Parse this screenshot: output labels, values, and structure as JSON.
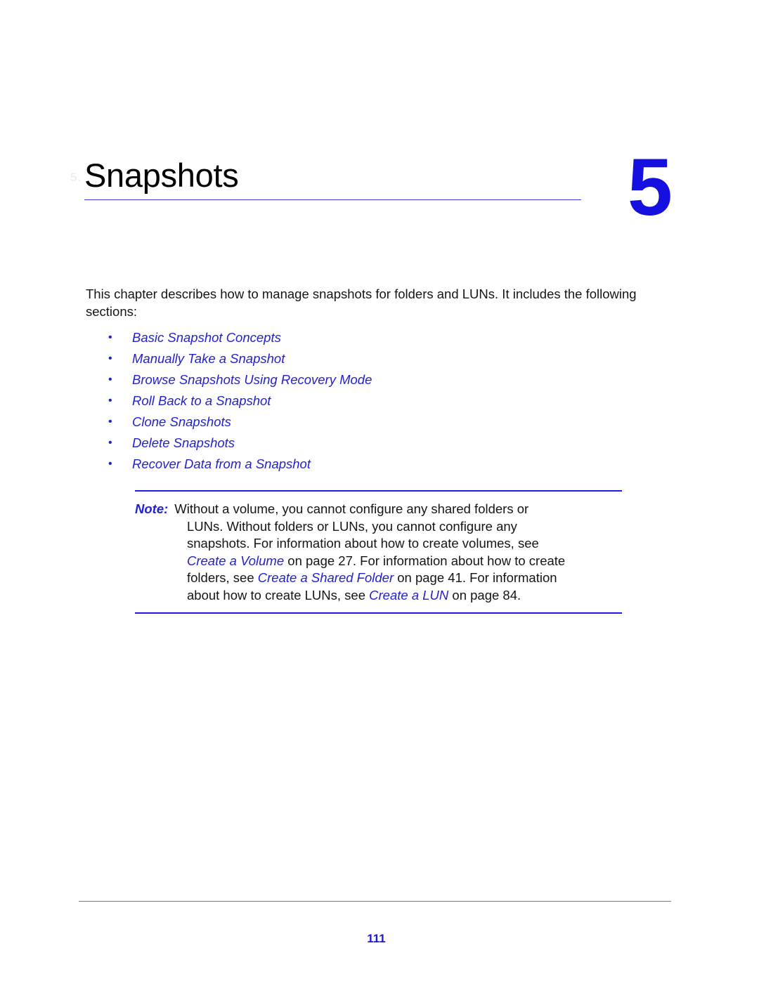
{
  "chapter": {
    "title": "Snapshots",
    "number": "5",
    "scan_mark": "5."
  },
  "intro": {
    "paragraph": "This chapter describes how to manage snapshots for folders and LUNs. It includes the following sections:"
  },
  "toc": {
    "bullet_glyph": "•",
    "items": [
      {
        "label": "Basic Snapshot Concepts"
      },
      {
        "label": "Manually Take a Snapshot"
      },
      {
        "label": "Browse Snapshots Using Recovery Mode"
      },
      {
        "label": "Roll Back to a Snapshot"
      },
      {
        "label": "Clone Snapshots"
      },
      {
        "label": "Delete Snapshots"
      },
      {
        "label": "Recover Data from a Snapshot"
      }
    ]
  },
  "note": {
    "label": "Note:",
    "line1": "Without a volume, you cannot configure any shared folders or",
    "line2": "LUNs. Without folders or LUNs, you cannot configure any",
    "line3": "snapshots. For information about how to create volumes, see",
    "line4_xref": "Create a Volume",
    "line4_rest": "on page 27. For information about how to create",
    "line5_pre": "folders, see",
    "line5_xref": "Create a Shared Folder",
    "line5_rest": "on page 41. For information",
    "line6_pre": "about how to create LUNs, see",
    "line6_xref": "Create a LUN",
    "line6_rest": "on page 84."
  },
  "footer": {
    "page_number": "111"
  },
  "colors": {
    "link_blue": "#2222CC",
    "chapter_number_blue": "#1510E0",
    "rule_blue": "#3A3AD8",
    "note_rule_blue": "#1C1CE0",
    "footer_rule_blue": "#6A6AEE",
    "body_black": "#151515"
  }
}
